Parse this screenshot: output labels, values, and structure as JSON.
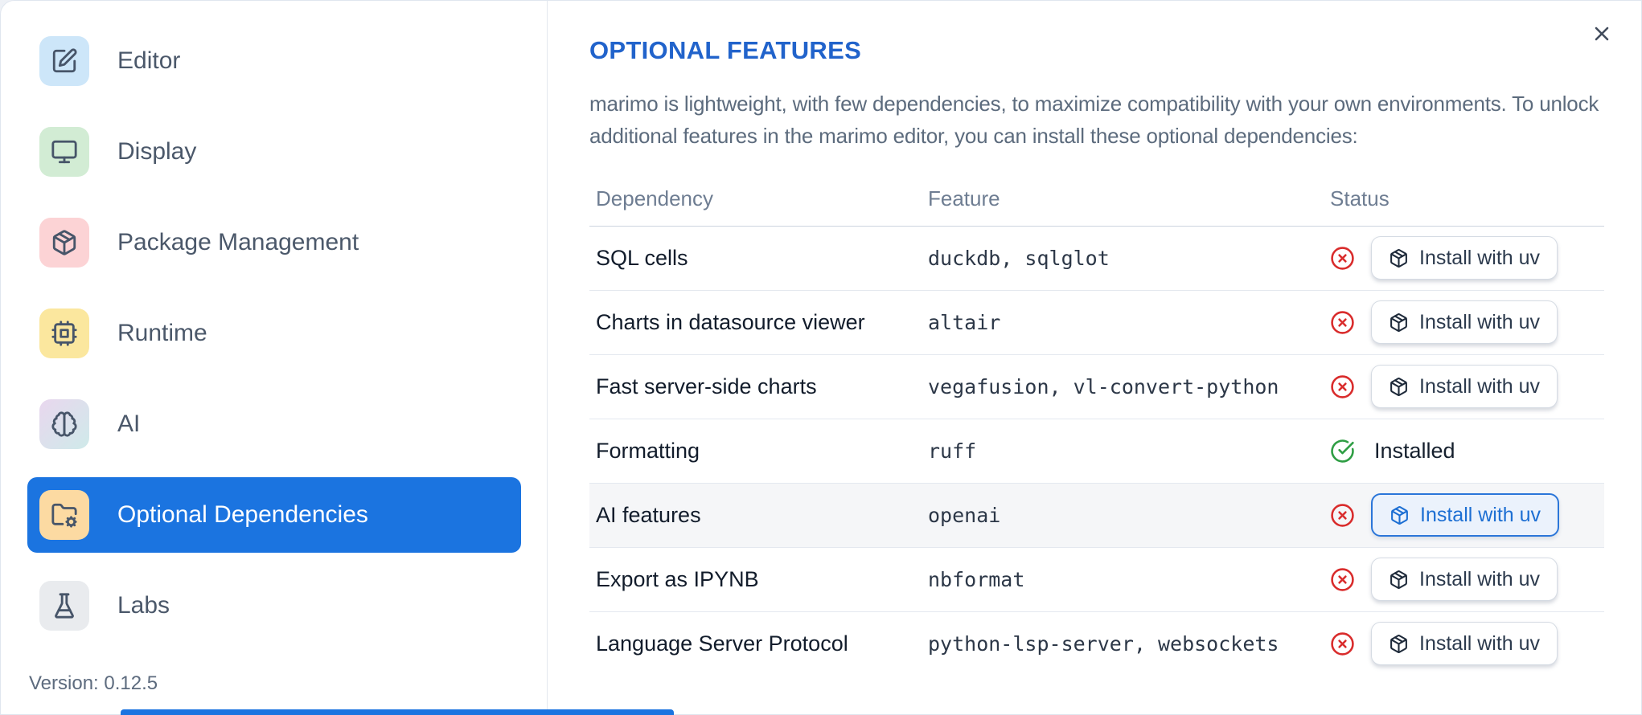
{
  "sidebar": {
    "items": [
      {
        "label": "Editor",
        "icon": "edit-icon",
        "tile_color": "#cde6f9",
        "selected": false
      },
      {
        "label": "Display",
        "icon": "monitor-icon",
        "tile_color": "#d2ecd4",
        "selected": false
      },
      {
        "label": "Package Management",
        "icon": "package-icon",
        "tile_color": "#fcd3d5",
        "selected": false
      },
      {
        "label": "Runtime",
        "icon": "cpu-icon",
        "tile_color": "#fbe79e",
        "selected": false
      },
      {
        "label": "AI",
        "icon": "brain-icon",
        "tile_color": "linear-gradient(135deg,#e9d7ee 0%,#cfeaea 100%)",
        "selected": false
      },
      {
        "label": "Optional Dependencies",
        "icon": "folder-cog-icon",
        "tile_color": "#fcdaa2",
        "selected": true
      },
      {
        "label": "Labs",
        "icon": "flask-icon",
        "tile_color": "#e9ebee",
        "selected": false
      }
    ],
    "version_label": "Version: 0.12.5"
  },
  "panel": {
    "title": "OPTIONAL FEATURES",
    "description": "marimo is lightweight, with few dependencies, to maximize compatibility with your own environments. To unlock additional features in the marimo editor, you can install these optional dependencies:",
    "close_icon": "x-icon",
    "table": {
      "headers": [
        "Dependency",
        "Feature",
        "Status"
      ],
      "install_button_label": "Install with uv",
      "installed_label": "Installed",
      "rows": [
        {
          "dependency": "SQL cells",
          "feature": "duckdb, sqlglot",
          "status": "missing",
          "highlighted": false
        },
        {
          "dependency": "Charts in datasource viewer",
          "feature": "altair",
          "status": "missing",
          "highlighted": false
        },
        {
          "dependency": "Fast server-side charts",
          "feature": "vegafusion, vl-convert-python",
          "status": "missing",
          "highlighted": false
        },
        {
          "dependency": "Formatting",
          "feature": "ruff",
          "status": "installed",
          "highlighted": false
        },
        {
          "dependency": "AI features",
          "feature": "openai",
          "status": "missing",
          "highlighted": true
        },
        {
          "dependency": "Export as IPYNB",
          "feature": "nbformat",
          "status": "missing",
          "highlighted": false
        },
        {
          "dependency": "Language Server Protocol",
          "feature": "python-lsp-server, websockets",
          "status": "missing",
          "highlighted": false
        }
      ]
    }
  },
  "colors": {
    "accent_blue": "#1b74e0",
    "title_blue": "#2163cb",
    "status_missing_red": "#d92c2c",
    "status_installed_green": "#2f9e44",
    "highlight_row_bg": "#f5f6f8"
  }
}
